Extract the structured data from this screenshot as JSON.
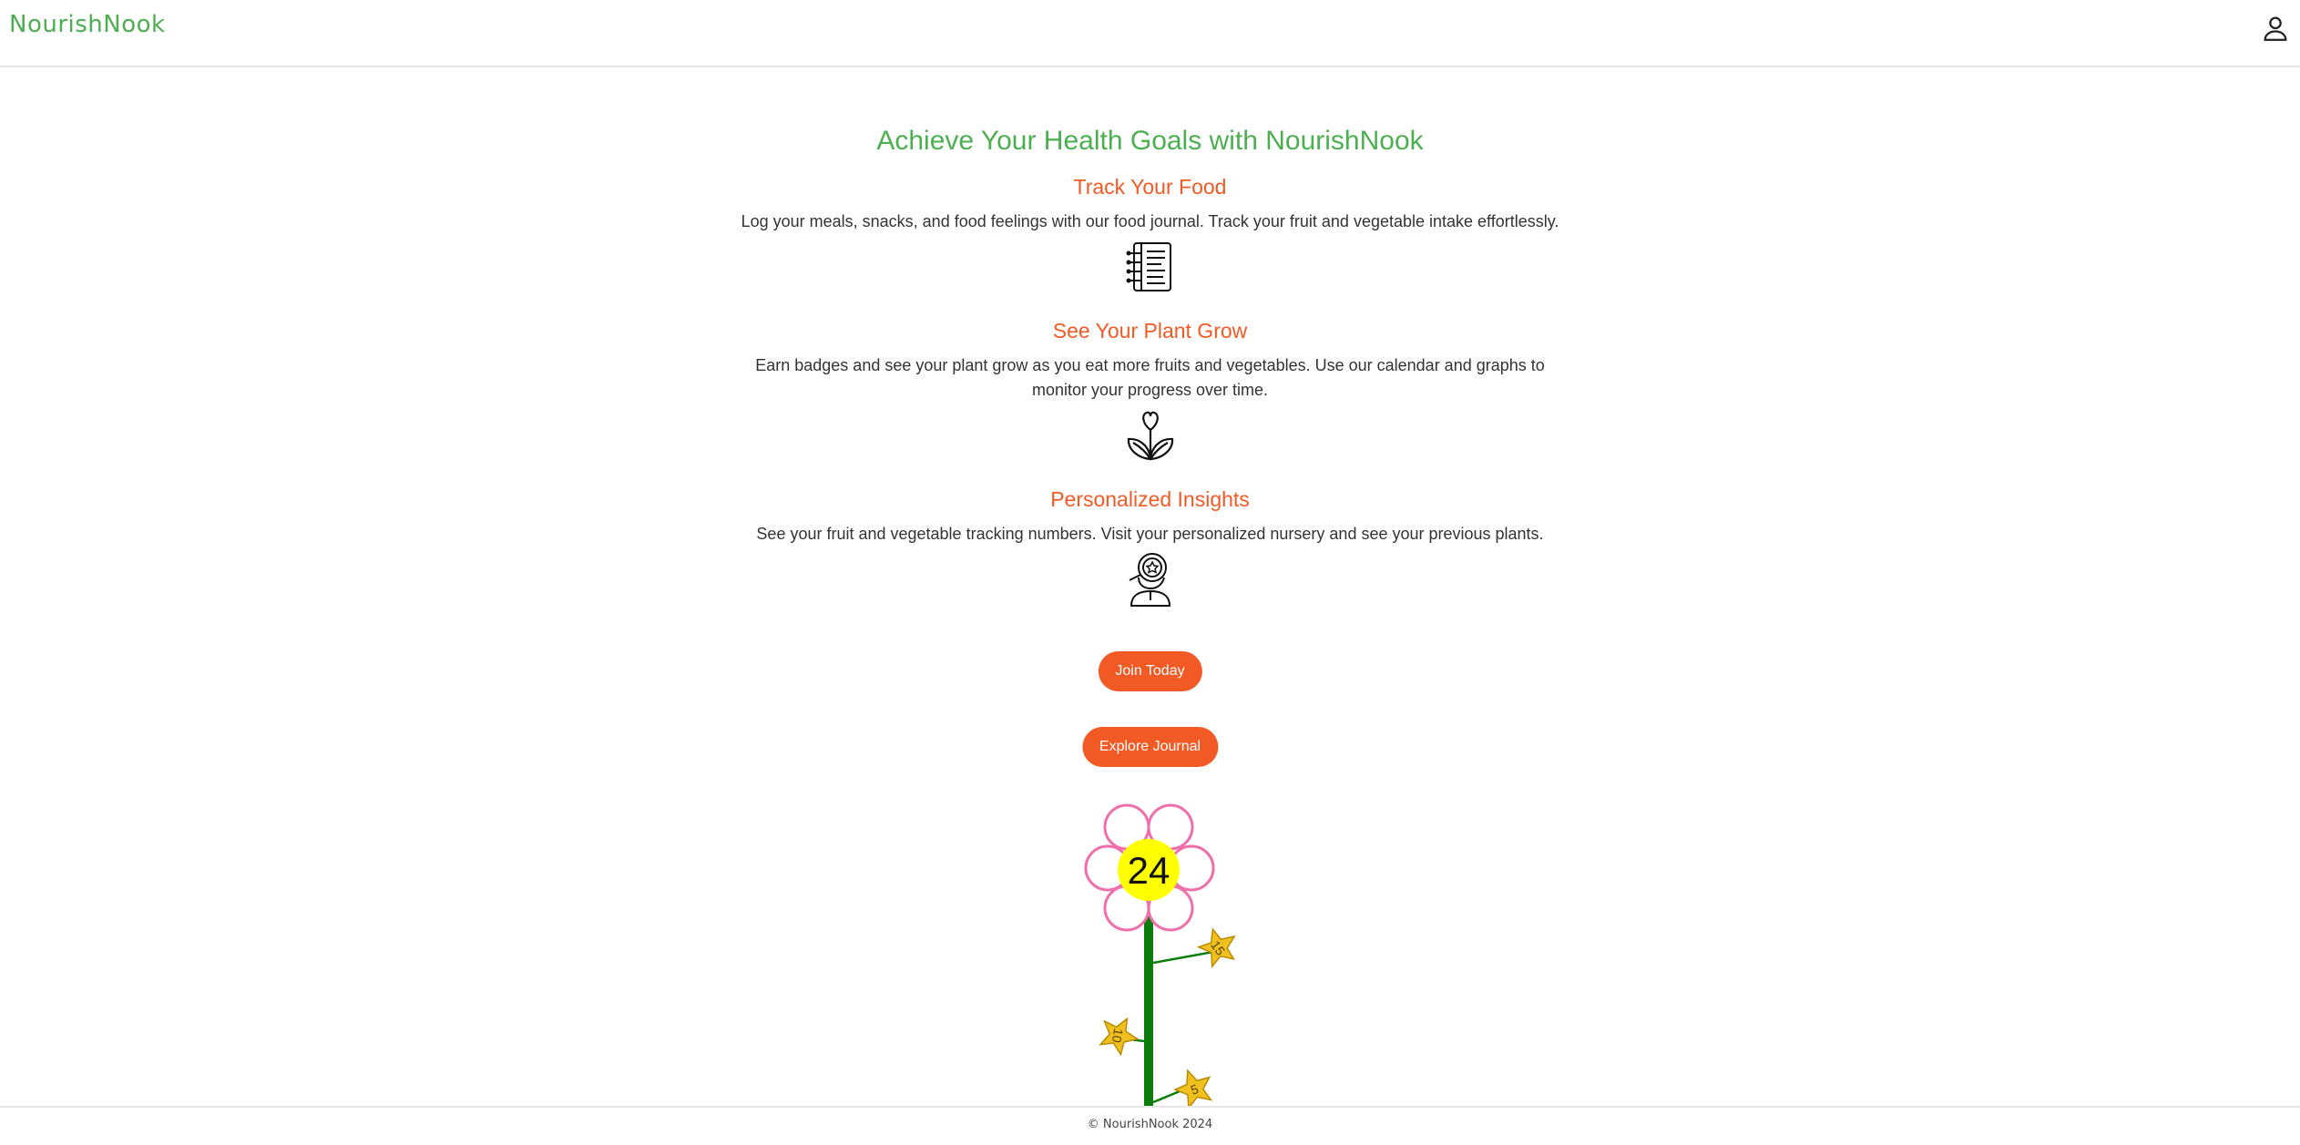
{
  "app": {
    "brand": "NourishNook"
  },
  "hero": {
    "title": "Achieve Your Health Goals with NourishNook"
  },
  "features": [
    {
      "title": "Track Your Food",
      "text": "Log your meals, snacks, and food feelings with our food journal. Track your fruit and vegetable intake effortlessly.",
      "icon": "journal-icon"
    },
    {
      "title": "See Your Plant Grow",
      "text": "Earn badges and see your plant grow as you eat more fruits and vegetables. Use our calendar and graphs to monitor your progress over time.",
      "icon": "plant-heart-icon"
    },
    {
      "title": "Personalized Insights",
      "text": "See your fruit and vegetable tracking numbers. Visit your personalized nursery and see your previous plants.",
      "icon": "person-award-icon"
    }
  ],
  "actions": {
    "join_label": "Join Today",
    "explore_label": "Explore Journal"
  },
  "plant": {
    "count": "24",
    "badges": [
      "15",
      "10",
      "5"
    ]
  },
  "footer": {
    "copyright": "© NourishNook 2024"
  },
  "colors": {
    "brand_green": "#4caf50",
    "accent_orange": "#f15a24",
    "stem_green": "#0a7d0a",
    "flower_center": "#ffff00",
    "petal_outline": "#f06ea9",
    "star_gold": "#f0c020"
  }
}
